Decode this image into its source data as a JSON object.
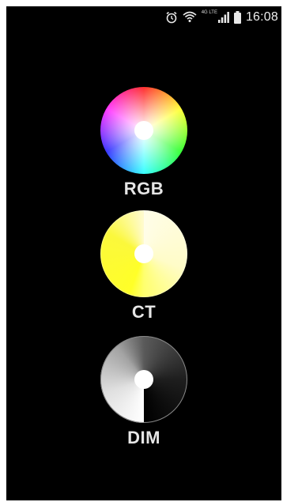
{
  "status_bar": {
    "network_label": "4G LTE",
    "time": "16:08",
    "icons": [
      "alarm-icon",
      "wifi-icon",
      "signal-icon",
      "battery-icon"
    ]
  },
  "modes": [
    {
      "id": "rgb",
      "label": "RGB",
      "wheel": "color-wheel-icon"
    },
    {
      "id": "ct",
      "label": "CT",
      "wheel": "color-temperature-wheel-icon"
    },
    {
      "id": "dim",
      "label": "DIM",
      "wheel": "dimmer-wheel-icon"
    }
  ],
  "colors": {
    "screen_background": "#000000",
    "label_text": "#e6e6e6",
    "status_text": "#eeeeee"
  }
}
